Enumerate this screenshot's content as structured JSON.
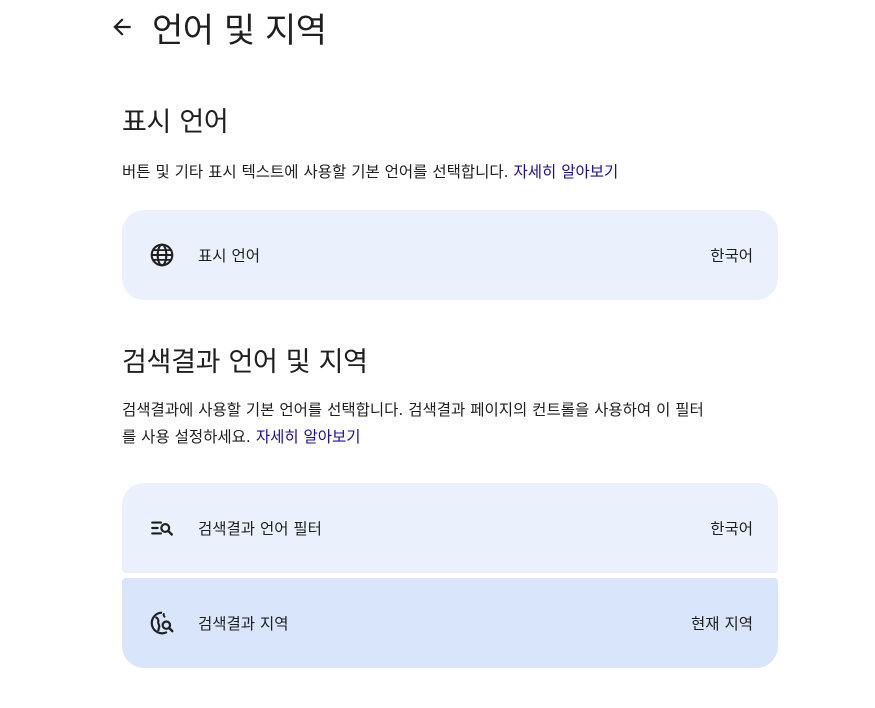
{
  "header": {
    "title": "언어 및 지역"
  },
  "display_language": {
    "title": "표시 언어",
    "description": "버튼 및 기타 표시 텍스트에 사용할 기본 언어를 선택합니다.",
    "learn_more": "자세히 알아보기",
    "item": {
      "icon": "globe-icon",
      "label": "표시 언어",
      "value": "한국어"
    }
  },
  "search_language": {
    "title": "검색결과 언어 및 지역",
    "description_line1": "검색결과에 사용할 기본 언어를 선택합니다. 검색결과 페이지의 컨트롤을 사용하여 이 필터",
    "description_line2": "를 사용 설정하세요.",
    "learn_more": "자세히 알아보기",
    "items": [
      {
        "icon": "filter-search-icon",
        "label": "검색결과 언어 필터",
        "value": "한국어"
      },
      {
        "icon": "globe-search-icon",
        "label": "검색결과 지역",
        "value": "현재 지역"
      }
    ]
  }
}
